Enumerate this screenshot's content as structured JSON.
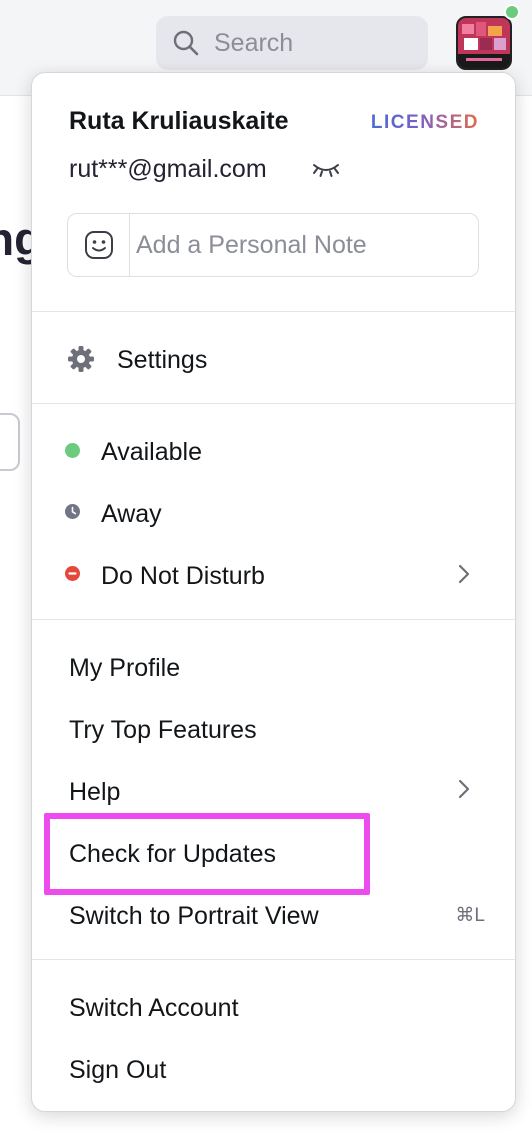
{
  "topbar": {
    "search_placeholder": "Search",
    "presence_color": "#6bcb7f"
  },
  "background": {
    "heading_fragment": "ng"
  },
  "profile": {
    "name": "Ruta Kruliauskaite",
    "plan_badge": "LICENSED",
    "email": "rut***@gmail.com",
    "note_placeholder": "Add a Personal Note"
  },
  "settings": {
    "label": "Settings"
  },
  "status": {
    "items": [
      {
        "label": "Available",
        "color": "#6bcb7f"
      },
      {
        "label": "Away",
        "color": "#747487"
      },
      {
        "label": "Do Not Disturb",
        "color": "#e4483b"
      }
    ]
  },
  "actions": {
    "my_profile": "My Profile",
    "try_top_features": "Try Top Features",
    "help": "Help",
    "check_for_updates": "Check for Updates",
    "switch_portrait": "Switch to Portrait View",
    "switch_portrait_shortcut": "⌘L"
  },
  "account": {
    "switch_account": "Switch Account",
    "sign_out": "Sign Out"
  },
  "highlight_color": "#ee4bee"
}
